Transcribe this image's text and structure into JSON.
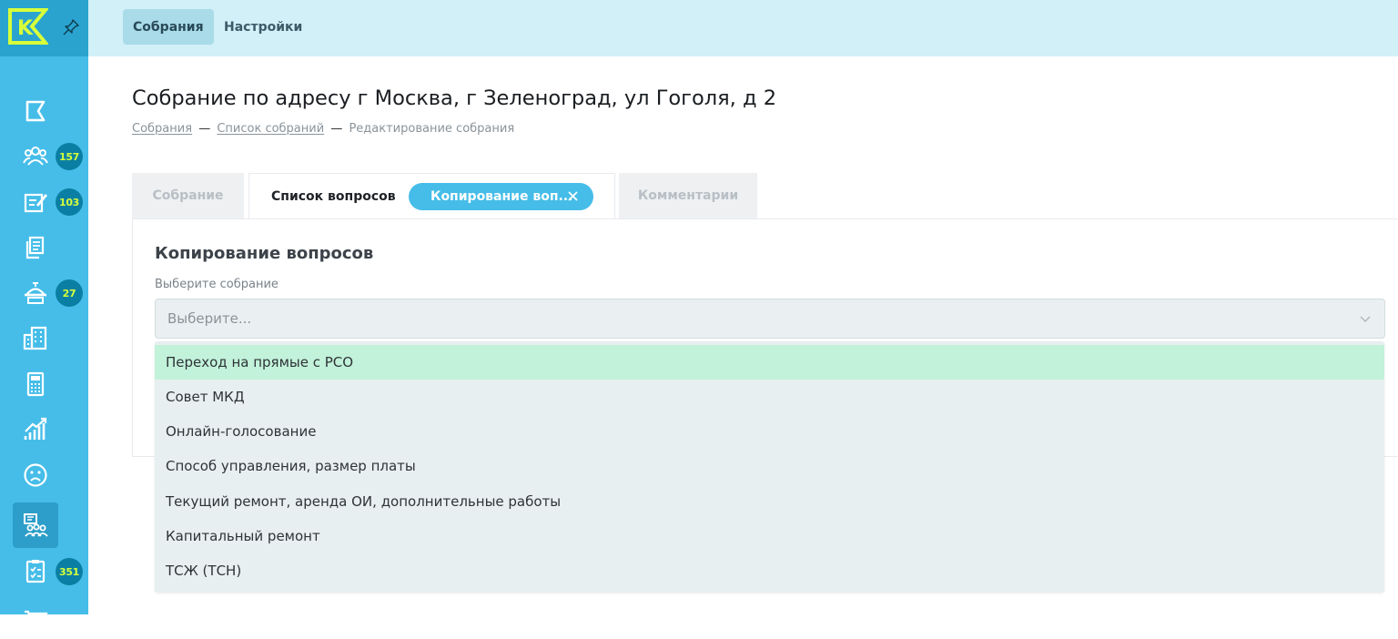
{
  "sidebar": {
    "logo_icon": "logo-k-icon",
    "pin_icon": "pin-icon",
    "items": [
      {
        "icon": "flag-icon",
        "badge": ""
      },
      {
        "icon": "people-group-icon",
        "badge": "157"
      },
      {
        "icon": "document-edit-icon",
        "badge": "103"
      },
      {
        "icon": "documents-icon",
        "badge": ""
      },
      {
        "icon": "concierge-icon",
        "badge": "27"
      },
      {
        "icon": "buildings-icon",
        "badge": ""
      },
      {
        "icon": "calculator-icon",
        "badge": ""
      },
      {
        "icon": "chart-growth-icon",
        "badge": ""
      },
      {
        "icon": "sad-face-icon",
        "badge": ""
      },
      {
        "icon": "meeting-icon",
        "badge": ""
      },
      {
        "icon": "checklist-icon",
        "badge": "351"
      },
      {
        "icon": "cart-icon",
        "badge": ""
      }
    ]
  },
  "topbar": {
    "tabs": [
      {
        "label": "Собрания",
        "active": true
      },
      {
        "label": "Настройки",
        "active": false
      }
    ]
  },
  "page": {
    "title": "Собрание по адресу г Москва, г Зеленоград, ул Гоголя, д 2",
    "breadcrumb": [
      "Собрания",
      "Список собраний",
      "Редактирование собрания"
    ],
    "breadcrumb_sep": "—"
  },
  "tabs": {
    "meeting": "Собрание",
    "questions": "Список вопросов",
    "copy": "Копирование воп...",
    "comments": "Комментарии"
  },
  "panel": {
    "title": "Копирование вопросов",
    "field_label": "Выберите собрание",
    "select_placeholder": "Выберите..."
  },
  "dropdown": {
    "options": [
      "Переход на прямые с РСО",
      "Совет МКД",
      "Онлайн-голосование",
      "Способ управления, размер платы",
      "Текущий ремонт, аренда ОИ, дополнительные работы",
      "Капитальный ремонт",
      "ТСЖ (ТСН)"
    ],
    "highlighted_index": 0
  },
  "colors": {
    "sidebar": "#45bde8",
    "accent": "#45bde8",
    "badge_bg": "#0b7fa3",
    "badge_text": "#d7ff3a",
    "highlight": "#c2f2da"
  }
}
